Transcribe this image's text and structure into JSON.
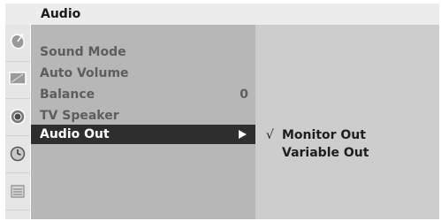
{
  "header": {
    "title": "Audio"
  },
  "sidebar": {
    "icons": [
      "satellite-dish-icon",
      "picture-screen-icon",
      "audio-speaker-icon",
      "clock-icon",
      "settings-lock-icon"
    ]
  },
  "menu": {
    "items": [
      {
        "label": "Sound Mode",
        "value": ""
      },
      {
        "label": "Auto Volume",
        "value": ""
      },
      {
        "label": "Balance",
        "value": "0"
      },
      {
        "label": "TV Speaker",
        "value": ""
      },
      {
        "label": "Audio Out",
        "value": "",
        "selected": true
      }
    ]
  },
  "submenu": {
    "options": [
      {
        "check": "√",
        "label": "Monitor Out",
        "checked": true
      },
      {
        "check": "",
        "label": "Variable Out",
        "checked": false
      }
    ]
  },
  "colors": {
    "selected_bg": "#2e2e2e",
    "panel_bg": "#b7b7b7",
    "submenu_bg": "#cdcdcd",
    "header_bg": "#ececec"
  }
}
